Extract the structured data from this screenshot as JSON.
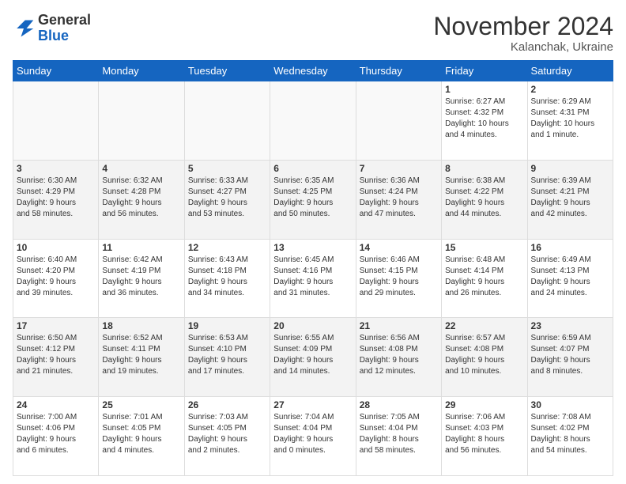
{
  "header": {
    "logo_line1": "General",
    "logo_line2": "Blue",
    "month": "November 2024",
    "location": "Kalanchak, Ukraine"
  },
  "weekdays": [
    "Sunday",
    "Monday",
    "Tuesday",
    "Wednesday",
    "Thursday",
    "Friday",
    "Saturday"
  ],
  "weeks": [
    [
      {
        "num": "",
        "info": ""
      },
      {
        "num": "",
        "info": ""
      },
      {
        "num": "",
        "info": ""
      },
      {
        "num": "",
        "info": ""
      },
      {
        "num": "",
        "info": ""
      },
      {
        "num": "1",
        "info": "Sunrise: 6:27 AM\nSunset: 4:32 PM\nDaylight: 10 hours\nand 4 minutes."
      },
      {
        "num": "2",
        "info": "Sunrise: 6:29 AM\nSunset: 4:31 PM\nDaylight: 10 hours\nand 1 minute."
      }
    ],
    [
      {
        "num": "3",
        "info": "Sunrise: 6:30 AM\nSunset: 4:29 PM\nDaylight: 9 hours\nand 58 minutes."
      },
      {
        "num": "4",
        "info": "Sunrise: 6:32 AM\nSunset: 4:28 PM\nDaylight: 9 hours\nand 56 minutes."
      },
      {
        "num": "5",
        "info": "Sunrise: 6:33 AM\nSunset: 4:27 PM\nDaylight: 9 hours\nand 53 minutes."
      },
      {
        "num": "6",
        "info": "Sunrise: 6:35 AM\nSunset: 4:25 PM\nDaylight: 9 hours\nand 50 minutes."
      },
      {
        "num": "7",
        "info": "Sunrise: 6:36 AM\nSunset: 4:24 PM\nDaylight: 9 hours\nand 47 minutes."
      },
      {
        "num": "8",
        "info": "Sunrise: 6:38 AM\nSunset: 4:22 PM\nDaylight: 9 hours\nand 44 minutes."
      },
      {
        "num": "9",
        "info": "Sunrise: 6:39 AM\nSunset: 4:21 PM\nDaylight: 9 hours\nand 42 minutes."
      }
    ],
    [
      {
        "num": "10",
        "info": "Sunrise: 6:40 AM\nSunset: 4:20 PM\nDaylight: 9 hours\nand 39 minutes."
      },
      {
        "num": "11",
        "info": "Sunrise: 6:42 AM\nSunset: 4:19 PM\nDaylight: 9 hours\nand 36 minutes."
      },
      {
        "num": "12",
        "info": "Sunrise: 6:43 AM\nSunset: 4:18 PM\nDaylight: 9 hours\nand 34 minutes."
      },
      {
        "num": "13",
        "info": "Sunrise: 6:45 AM\nSunset: 4:16 PM\nDaylight: 9 hours\nand 31 minutes."
      },
      {
        "num": "14",
        "info": "Sunrise: 6:46 AM\nSunset: 4:15 PM\nDaylight: 9 hours\nand 29 minutes."
      },
      {
        "num": "15",
        "info": "Sunrise: 6:48 AM\nSunset: 4:14 PM\nDaylight: 9 hours\nand 26 minutes."
      },
      {
        "num": "16",
        "info": "Sunrise: 6:49 AM\nSunset: 4:13 PM\nDaylight: 9 hours\nand 24 minutes."
      }
    ],
    [
      {
        "num": "17",
        "info": "Sunrise: 6:50 AM\nSunset: 4:12 PM\nDaylight: 9 hours\nand 21 minutes."
      },
      {
        "num": "18",
        "info": "Sunrise: 6:52 AM\nSunset: 4:11 PM\nDaylight: 9 hours\nand 19 minutes."
      },
      {
        "num": "19",
        "info": "Sunrise: 6:53 AM\nSunset: 4:10 PM\nDaylight: 9 hours\nand 17 minutes."
      },
      {
        "num": "20",
        "info": "Sunrise: 6:55 AM\nSunset: 4:09 PM\nDaylight: 9 hours\nand 14 minutes."
      },
      {
        "num": "21",
        "info": "Sunrise: 6:56 AM\nSunset: 4:08 PM\nDaylight: 9 hours\nand 12 minutes."
      },
      {
        "num": "22",
        "info": "Sunrise: 6:57 AM\nSunset: 4:08 PM\nDaylight: 9 hours\nand 10 minutes."
      },
      {
        "num": "23",
        "info": "Sunrise: 6:59 AM\nSunset: 4:07 PM\nDaylight: 9 hours\nand 8 minutes."
      }
    ],
    [
      {
        "num": "24",
        "info": "Sunrise: 7:00 AM\nSunset: 4:06 PM\nDaylight: 9 hours\nand 6 minutes."
      },
      {
        "num": "25",
        "info": "Sunrise: 7:01 AM\nSunset: 4:05 PM\nDaylight: 9 hours\nand 4 minutes."
      },
      {
        "num": "26",
        "info": "Sunrise: 7:03 AM\nSunset: 4:05 PM\nDaylight: 9 hours\nand 2 minutes."
      },
      {
        "num": "27",
        "info": "Sunrise: 7:04 AM\nSunset: 4:04 PM\nDaylight: 9 hours\nand 0 minutes."
      },
      {
        "num": "28",
        "info": "Sunrise: 7:05 AM\nSunset: 4:04 PM\nDaylight: 8 hours\nand 58 minutes."
      },
      {
        "num": "29",
        "info": "Sunrise: 7:06 AM\nSunset: 4:03 PM\nDaylight: 8 hours\nand 56 minutes."
      },
      {
        "num": "30",
        "info": "Sunrise: 7:08 AM\nSunset: 4:02 PM\nDaylight: 8 hours\nand 54 minutes."
      }
    ]
  ]
}
